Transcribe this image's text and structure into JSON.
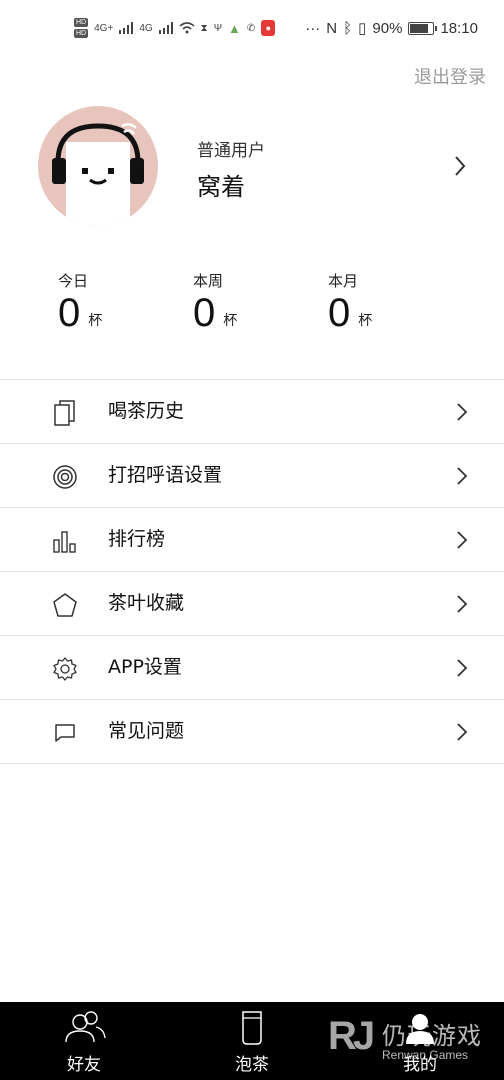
{
  "status_bar": {
    "hd1": "HD",
    "hd2": "HD",
    "network1": "4G+",
    "network2": "4G",
    "more": "···",
    "nfc": "N",
    "battery": "90%",
    "time": "18:10"
  },
  "header": {
    "logout": "退出登录"
  },
  "profile": {
    "user_type": "普通用户",
    "name": "窝着",
    "avatar_bg": "#e7c4bc"
  },
  "stats": [
    {
      "label": "今日",
      "value": "0",
      "unit": "杯"
    },
    {
      "label": "本周",
      "value": "0",
      "unit": "杯"
    },
    {
      "label": "本月",
      "value": "0",
      "unit": "杯"
    }
  ],
  "menu": [
    {
      "label": "喝茶历史",
      "icon": "tea-history-icon"
    },
    {
      "label": "打招呼语设置",
      "icon": "greeting-target-icon"
    },
    {
      "label": "排行榜",
      "icon": "ranking-bars-icon"
    },
    {
      "label": "茶叶收藏",
      "icon": "star-icon"
    },
    {
      "label": "APP设置",
      "icon": "gear-icon"
    },
    {
      "label": "常见问题",
      "icon": "chat-bubble-icon"
    }
  ],
  "bottom_nav": [
    {
      "label": "好友",
      "icon": "friends-icon"
    },
    {
      "label": "泡茶",
      "icon": "cup-icon"
    },
    {
      "label": "我的",
      "icon": "profile-icon"
    }
  ],
  "watermark": {
    "mark": "RJ",
    "cn": "仍玩游戏",
    "en": "Renwan Games"
  }
}
